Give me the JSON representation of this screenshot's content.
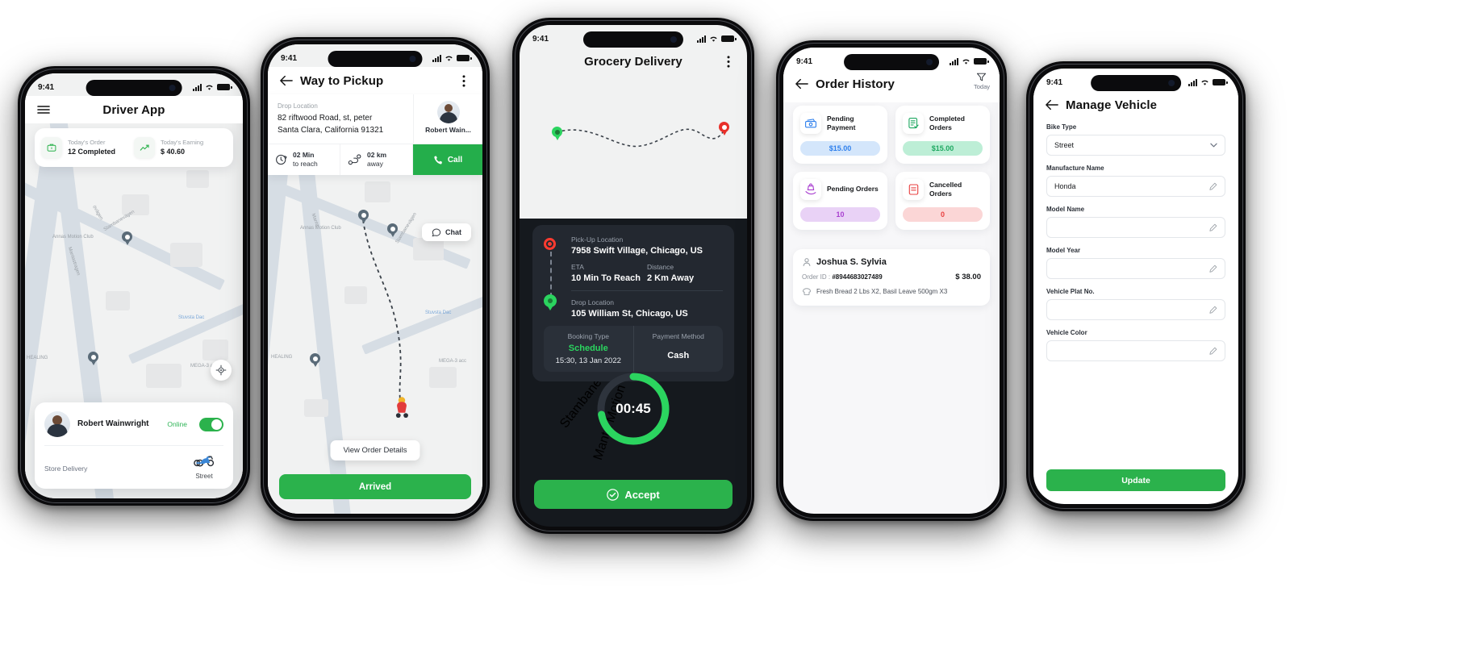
{
  "colors": {
    "green": "#2bb24c",
    "dark_panel": "#232830",
    "blue": "#2f80ed",
    "purple": "#a93fd0",
    "red": "#e84040"
  },
  "phone1": {
    "status": {
      "time": "9:41"
    },
    "appbar": {
      "title": "Driver App",
      "menu_icon": "hamburger-icon"
    },
    "stats": [
      {
        "icon": "briefcase-icon",
        "label": "Today's Order",
        "value": "12 Completed"
      },
      {
        "icon": "trend-up-icon",
        "label": "Today's Earning",
        "value": "$ 40.60"
      }
    ],
    "map_labels": [
      "Mantastragen",
      "Stambanevägen",
      "Annas Motion Club",
      "Stuvsta Dac",
      "HEALING",
      "MEGA-3 acc",
      "övägen"
    ],
    "driver": {
      "name": "Robert Wainwright",
      "status_label": "Online",
      "toggle_on": true
    },
    "delivery": {
      "label": "Store Delivery",
      "vehicle_icon": "scooter-icon",
      "vehicle_name": "Street"
    },
    "locate_icon": "locate-target-icon"
  },
  "phone2": {
    "status": {
      "time": "9:41"
    },
    "appbar": {
      "title": "Way to Pickup",
      "back_icon": "arrow-left-icon",
      "more_icon": "more-vertical-icon"
    },
    "drop": {
      "label": "Drop Location",
      "address_line1": "82 riftwood Road, st, peter",
      "address_line2": "Santa Clara, California 91321"
    },
    "contact": {
      "name": "Robert Wain...",
      "avatar": "driver-avatar"
    },
    "eta": {
      "icon": "clock-icon",
      "value": "02 Min",
      "sub": "to reach"
    },
    "distance": {
      "icon": "route-icon",
      "value": "02 km",
      "sub": "away"
    },
    "call_button": {
      "label": "Call",
      "icon": "phone-icon"
    },
    "chat_button": {
      "label": "Chat",
      "icon": "chat-bubble-icon"
    },
    "view_order_button": "View Order Details",
    "primary_button": "Arrived",
    "map_labels": [
      "Manta",
      "Annas Motion Club",
      "Stambanevägen",
      "Stuvsta Dac",
      "HEALING",
      "MEGA-3 acc",
      "övägen"
    ]
  },
  "phone3": {
    "status": {
      "time": "9:41"
    },
    "appbar": {
      "title": "Grocery Delivery",
      "more_icon": "more-vertical-icon"
    },
    "map_labels": [
      "Stambanevägen",
      "Manta Motion Club"
    ],
    "pickup": {
      "label": "Pick-Up Location",
      "value": "7958 Swift Village, Chicago, US",
      "marker": "red-circle-marker"
    },
    "eta": {
      "label": "ETA",
      "value": "10 Min To Reach"
    },
    "distance": {
      "label": "Distance",
      "value": "2 Km Away"
    },
    "drop": {
      "label": "Drop Location",
      "value": "105 William St, Chicago, US",
      "marker": "green-pin-marker"
    },
    "booking": {
      "label": "Booking Type",
      "value": "Schedule",
      "datetime": "15:30, 13 Jan 2022"
    },
    "payment": {
      "label": "Payment Method",
      "value": "Cash"
    },
    "timer": {
      "value": "00:45",
      "progress_percent": 72
    },
    "accept_button": {
      "label": "Accept",
      "icon": "check-circle-icon"
    }
  },
  "phone4": {
    "status": {
      "time": "9:41"
    },
    "appbar": {
      "title": "Order History",
      "back_icon": "arrow-left-icon"
    },
    "filter": {
      "icon": "filter-funnel-icon",
      "label": "Today"
    },
    "stats": [
      {
        "icon": "cash-icon",
        "label": "Pending Payment",
        "value": "$15.00",
        "color": "#2f80ed",
        "pill_bg": "#d4e6fb"
      },
      {
        "icon": "checklist-icon",
        "label": "Completed Orders",
        "value": "$15.00",
        "color": "#1fa861",
        "pill_bg": "#bdeed6"
      },
      {
        "icon": "hand-bag-icon",
        "label": "Pending Orders",
        "value": "10",
        "color": "#a93fd0",
        "pill_bg": "#e9d2f6"
      },
      {
        "icon": "cancel-doc-icon",
        "label": "Cancelled Orders",
        "value": "0",
        "color": "#e84040",
        "pill_bg": "#fbd6d6"
      }
    ],
    "order": {
      "customer": "Joshua S. Sylvia",
      "order_id_label": "Order ID :",
      "order_id": "#8944683027489",
      "price": "$ 38.00",
      "items": "Fresh Bread 2 Lbs X2, Basil Leave 500gm X3",
      "item_icon": "bread-icon",
      "user_icon": "user-icon"
    }
  },
  "phone5": {
    "status": {
      "time": "9:41"
    },
    "appbar": {
      "title": "Manage Vehicle",
      "back_icon": "arrow-left-icon"
    },
    "fields": [
      {
        "label": "Bike Type",
        "value": "Street",
        "placeholder": "",
        "control": "dropdown",
        "icon": "chevron-down-icon"
      },
      {
        "label": "Manufacture Name",
        "value": "Honda",
        "placeholder": "",
        "control": "text",
        "icon": "pencil-icon"
      },
      {
        "label": "Model Name",
        "value": "",
        "placeholder": "",
        "control": "text",
        "icon": "pencil-icon"
      },
      {
        "label": "Model Year",
        "value": "",
        "placeholder": "",
        "control": "text",
        "icon": "pencil-icon"
      },
      {
        "label": "Vehicle Plat No.",
        "value": "",
        "placeholder": "",
        "control": "text",
        "icon": "pencil-icon"
      },
      {
        "label": "Vehicle Color",
        "value": "",
        "placeholder": "",
        "control": "text",
        "icon": "pencil-icon"
      }
    ],
    "update_button": "Update"
  }
}
